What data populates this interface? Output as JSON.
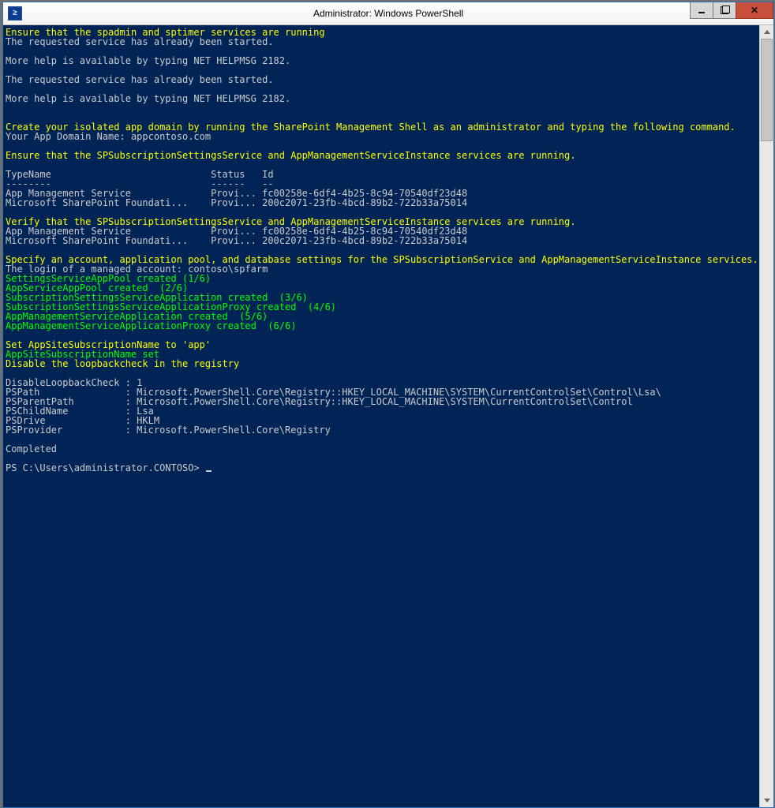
{
  "title": "Administrator: Windows PowerShell",
  "icons": {
    "app": "≥",
    "min": "min",
    "max": "max",
    "close": "x"
  },
  "prompt": "PS C:\\Users\\administrator.CONTOSO> ",
  "lines": [
    {
      "c": "yellow",
      "t": "Ensure that the spadmin and sptimer services are running"
    },
    {
      "c": "",
      "t": "The requested service has already been started."
    },
    {
      "c": "",
      "t": ""
    },
    {
      "c": "",
      "t": "More help is available by typing NET HELPMSG 2182."
    },
    {
      "c": "",
      "t": ""
    },
    {
      "c": "",
      "t": "The requested service has already been started."
    },
    {
      "c": "",
      "t": ""
    },
    {
      "c": "",
      "t": "More help is available by typing NET HELPMSG 2182."
    },
    {
      "c": "",
      "t": ""
    },
    {
      "c": "",
      "t": ""
    },
    {
      "c": "yellow",
      "t": "Create your isolated app domain by running the SharePoint Management Shell as an administrator and typing the following command."
    },
    {
      "c": "",
      "t": "Your App Domain Name: appcontoso.com"
    },
    {
      "c": "",
      "t": ""
    },
    {
      "c": "yellow",
      "t": "Ensure that the SPSubscriptionSettingsService and AppManagementServiceInstance services are running."
    },
    {
      "c": "",
      "t": ""
    },
    {
      "c": "",
      "t": "TypeName                            Status   Id"
    },
    {
      "c": "",
      "t": "--------                            ------   --"
    },
    {
      "c": "",
      "t": "App Management Service              Provi... fc00258e-6df4-4b25-8c94-70540df23d48"
    },
    {
      "c": "",
      "t": "Microsoft SharePoint Foundati...    Provi... 200c2071-23fb-4bcd-89b2-722b33a75014"
    },
    {
      "c": "",
      "t": ""
    },
    {
      "c": "yellow",
      "t": "Verify that the SPSubscriptionSettingsService and AppManagementServiceInstance services are running."
    },
    {
      "c": "",
      "t": "App Management Service              Provi... fc00258e-6df4-4b25-8c94-70540df23d48"
    },
    {
      "c": "",
      "t": "Microsoft SharePoint Foundati...    Provi... 200c2071-23fb-4bcd-89b2-722b33a75014"
    },
    {
      "c": "",
      "t": ""
    },
    {
      "c": "yellow",
      "t": "Specify an account, application pool, and database settings for the SPSubscriptionService and AppManagementServiceInstance services."
    },
    {
      "c": "",
      "t": "The login of a managed account: contoso\\spfarm"
    },
    {
      "c": "green",
      "t": "SettingsServiceAppPool created (1/6)"
    },
    {
      "c": "green",
      "t": "AppServiceAppPool created  (2/6)"
    },
    {
      "c": "green",
      "t": "SubscriptionSettingsServiceApplication created  (3/6)"
    },
    {
      "c": "green",
      "t": "SubscriptionSettingsServiceApplicationProxy created  (4/6)"
    },
    {
      "c": "green",
      "t": "AppManagementServiceApplication created  (5/6)"
    },
    {
      "c": "green",
      "t": "AppManagementServiceApplicationProxy created  (6/6)"
    },
    {
      "c": "",
      "t": ""
    },
    {
      "c": "yellow",
      "t": "Set AppSiteSubscriptionName to 'app'"
    },
    {
      "c": "green",
      "t": "AppSiteSubscriptionName set"
    },
    {
      "c": "yellow",
      "t": "Disable the loopbackcheck in the registry"
    },
    {
      "c": "",
      "t": ""
    },
    {
      "c": "",
      "t": "DisableLoopbackCheck : 1"
    },
    {
      "c": "",
      "t": "PSPath               : Microsoft.PowerShell.Core\\Registry::HKEY_LOCAL_MACHINE\\SYSTEM\\CurrentControlSet\\Control\\Lsa\\"
    },
    {
      "c": "",
      "t": "PSParentPath         : Microsoft.PowerShell.Core\\Registry::HKEY_LOCAL_MACHINE\\SYSTEM\\CurrentControlSet\\Control"
    },
    {
      "c": "",
      "t": "PSChildName          : Lsa"
    },
    {
      "c": "",
      "t": "PSDrive              : HKLM"
    },
    {
      "c": "",
      "t": "PSProvider           : Microsoft.PowerShell.Core\\Registry"
    },
    {
      "c": "",
      "t": ""
    },
    {
      "c": "",
      "t": "Completed"
    },
    {
      "c": "",
      "t": ""
    }
  ]
}
